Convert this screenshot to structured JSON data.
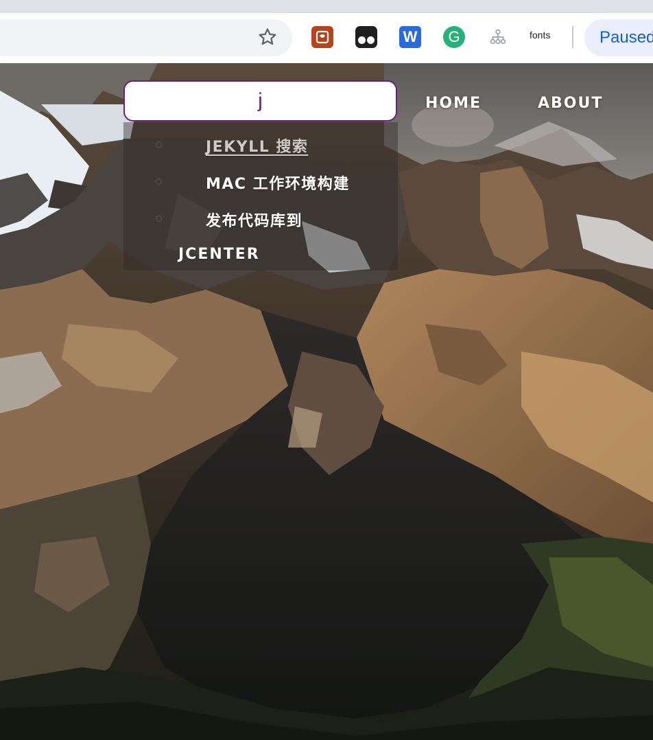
{
  "browser": {
    "toolbar": {
      "bookmark_icon": "star-outline-icon",
      "extensions": [
        {
          "name": "ext-orange-icon",
          "color": "#b3441e"
        },
        {
          "name": "ext-eyes-icon",
          "color": "#1f1f1f"
        },
        {
          "name": "ext-w-icon",
          "color": "#2a6ad9",
          "glyph": "W"
        },
        {
          "name": "grammarly-icon",
          "color": "#27b07b",
          "glyph": "G"
        },
        {
          "name": "sitemap-icon",
          "color": "#9aa0a6"
        }
      ],
      "fonts_label": "fonts",
      "profile_label": "Paused"
    }
  },
  "page": {
    "nav": {
      "home": "HOME",
      "about": "ABOUT"
    },
    "search": {
      "value": "j",
      "border_color": "#6b1f7a"
    },
    "results": [
      {
        "label": "JEKYLL 搜索",
        "visited": true
      },
      {
        "label": "MAC 工作环境构建",
        "visited": false
      },
      {
        "label": "发布代码库到",
        "continuation": "JCENTER",
        "visited": false
      }
    ]
  }
}
